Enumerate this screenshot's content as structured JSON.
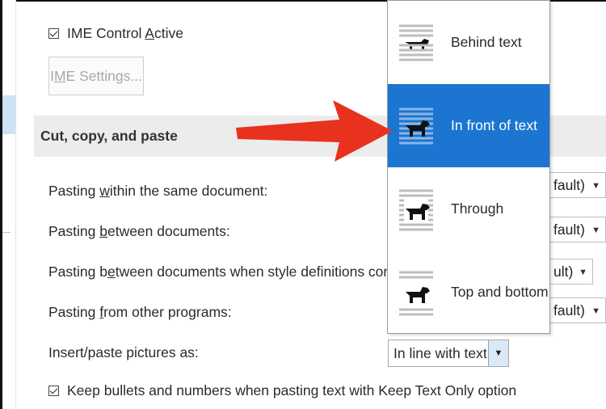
{
  "general": {
    "ime_control_label": "IME Control Active",
    "ime_settings_label": "IME Settings..."
  },
  "cut_copy_paste": {
    "section_title": "Cut, copy, and paste",
    "rows": [
      {
        "pre": "Pasting ",
        "u": "w",
        "post": "ithin the same document:",
        "value": "fault)"
      },
      {
        "pre": "Pasting ",
        "u": "b",
        "post": "etween documents:",
        "value": "fault)"
      },
      {
        "pre": "Pasting b",
        "u": "e",
        "post": "tween documents when style definitions conflict:",
        "value": "ult)"
      },
      {
        "pre": "Pasting ",
        "u": "f",
        "post": "rom other programs:",
        "value": "fault)"
      }
    ],
    "insert_paste_label": "Insert/paste pictures as:",
    "insert_paste_value": "In line with text",
    "keep_bullets_label": "Keep bullets and numbers when pasting text with Keep Text Only option"
  },
  "wrap_dropdown": {
    "options": [
      {
        "label": "Behind text",
        "icon": "behind-text-icon",
        "selected": false
      },
      {
        "label": "In front of text",
        "icon": "in-front-of-text-icon",
        "selected": true
      },
      {
        "label": "Through",
        "icon": "through-wrap-icon",
        "selected": false
      },
      {
        "label": "Top and bottom",
        "icon": "top-and-bottom-icon",
        "selected": false
      }
    ]
  },
  "colors": {
    "selected_bg": "#1b75d1",
    "arrow_red": "#e8321e",
    "section_bg": "#ececec"
  }
}
